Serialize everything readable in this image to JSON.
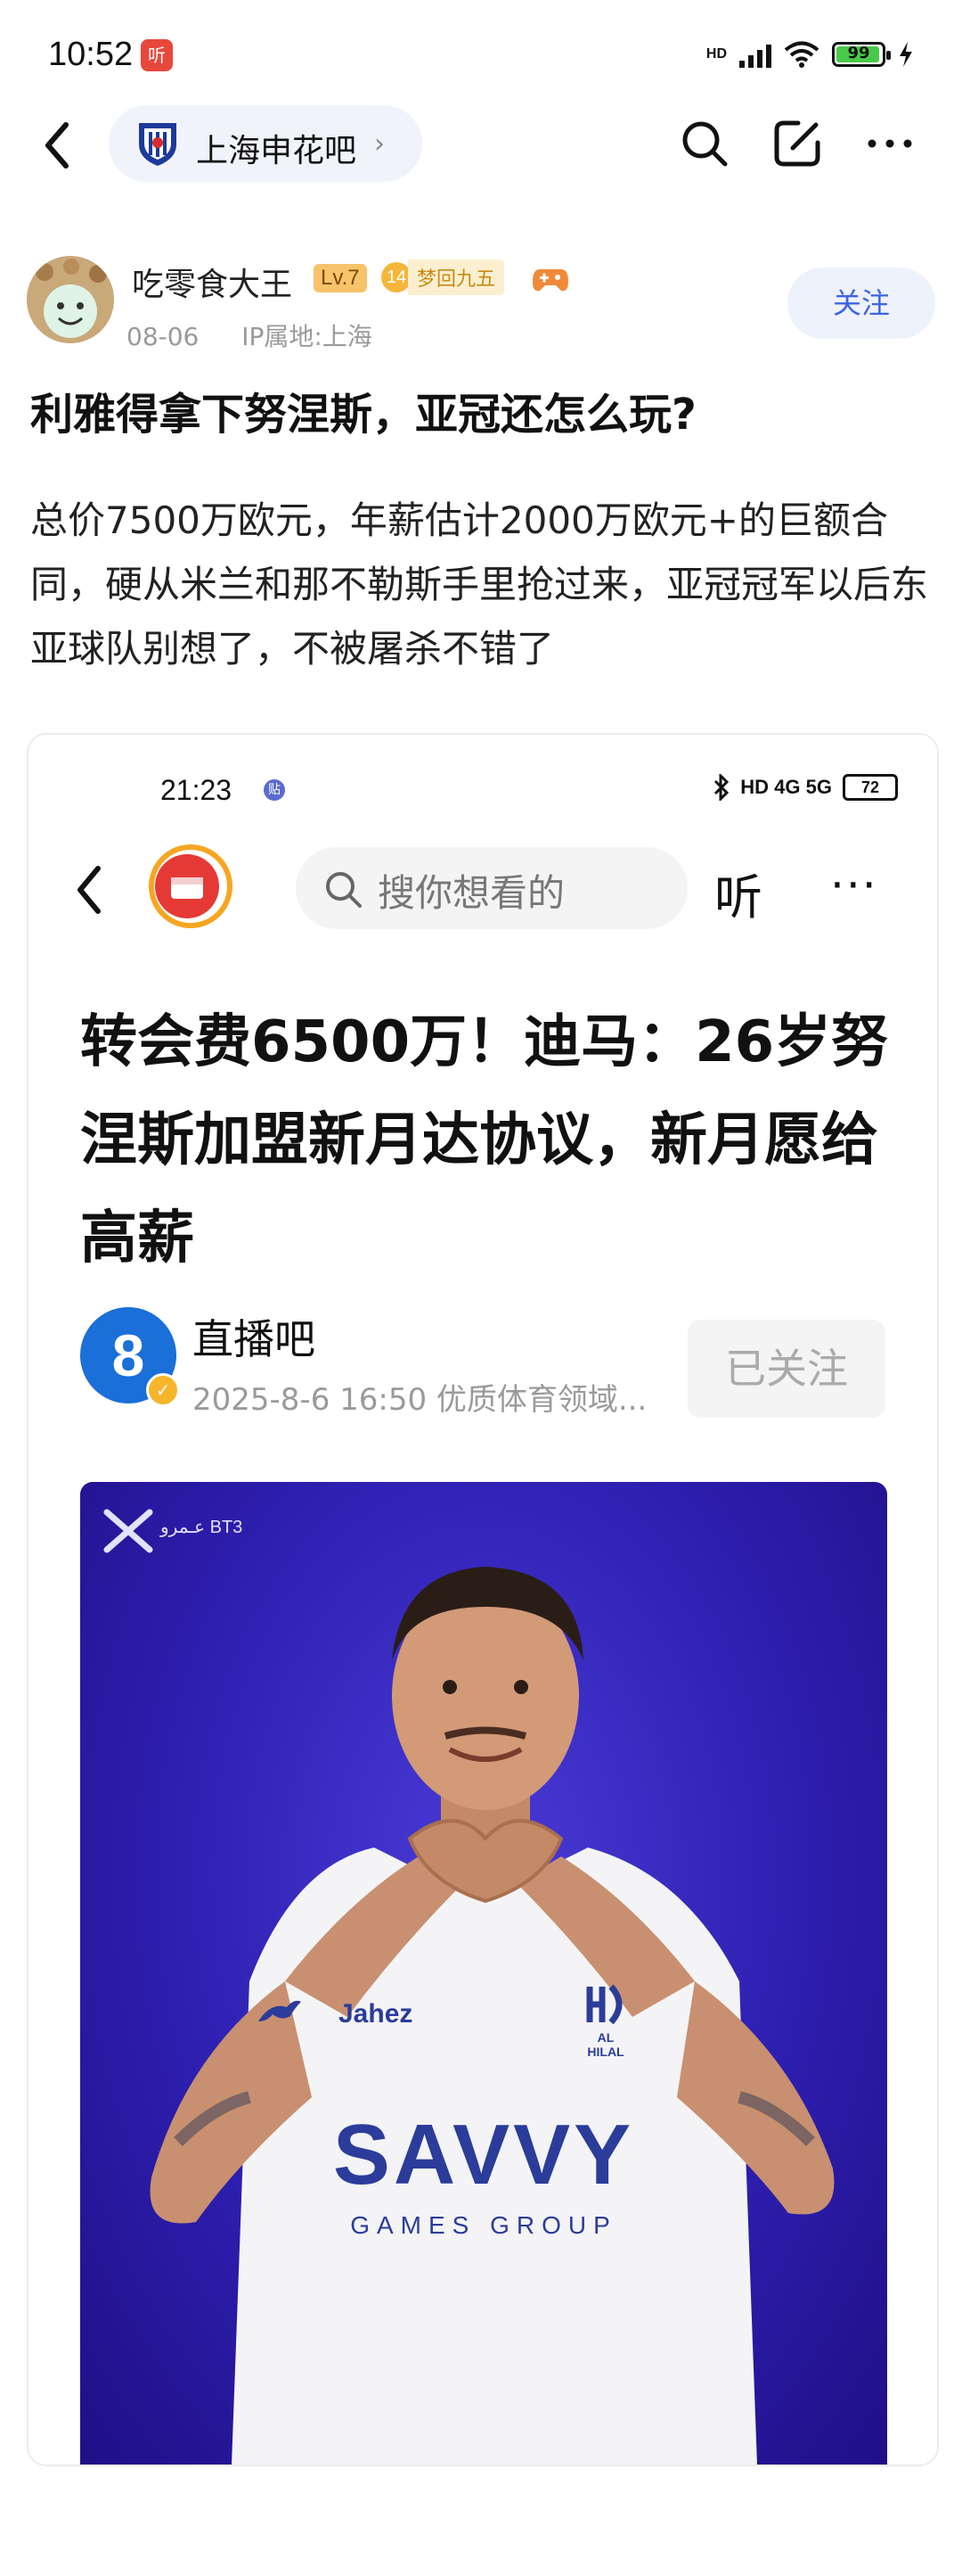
{
  "status_bar": {
    "time": "10:52",
    "app_icon_text": "听",
    "network": "HD",
    "battery": "99"
  },
  "nav": {
    "forum_name": "上海申花吧",
    "chevron": "›",
    "icons": [
      "back-icon",
      "search-icon",
      "edit-icon",
      "more-icon"
    ]
  },
  "author": {
    "name": "吃零食大王",
    "level": "Lv.7",
    "fan_level": "14",
    "fan_title": "梦回九五",
    "date": "08-06",
    "ip": "IP属地:上海",
    "follow_label": "关注"
  },
  "post": {
    "title": "利雅得拿下努涅斯，亚冠还怎么玩?",
    "body": "总价7500万欧元，年薪估计2000万欧元+的巨额合同，硬从米兰和那不勒斯手里抢过来，亚冠冠军以后东亚球队别想了，不被屠杀不错了"
  },
  "embedded": {
    "time": "21:23",
    "status_dot": "贴",
    "network": "HD 4G 5G",
    "battery": "72",
    "search_placeholder": "搜你想看的",
    "listen_label": "听",
    "more_label": "···",
    "headline": "转会费6500万！迪马：26岁努涅斯加盟新月达协议，新月愿给高薪",
    "source_logo": "8",
    "source_name": "直播吧",
    "source_meta": "2025-8-6  16:50  优质体育领域...",
    "follow_label": "已关注",
    "photo": {
      "brand_top": "عـمرو BT3",
      "sponsor": "SAVVY",
      "sponsor_sub": "GAMES GROUP",
      "chest_brand": "Jahez",
      "club_crest": "AL HILAL"
    }
  },
  "colors": {
    "accent": "#3d64e0",
    "follow_bg": "#eef2fd",
    "level_badge": "#f7c46b",
    "photo_bg": "#2d1fb0"
  }
}
